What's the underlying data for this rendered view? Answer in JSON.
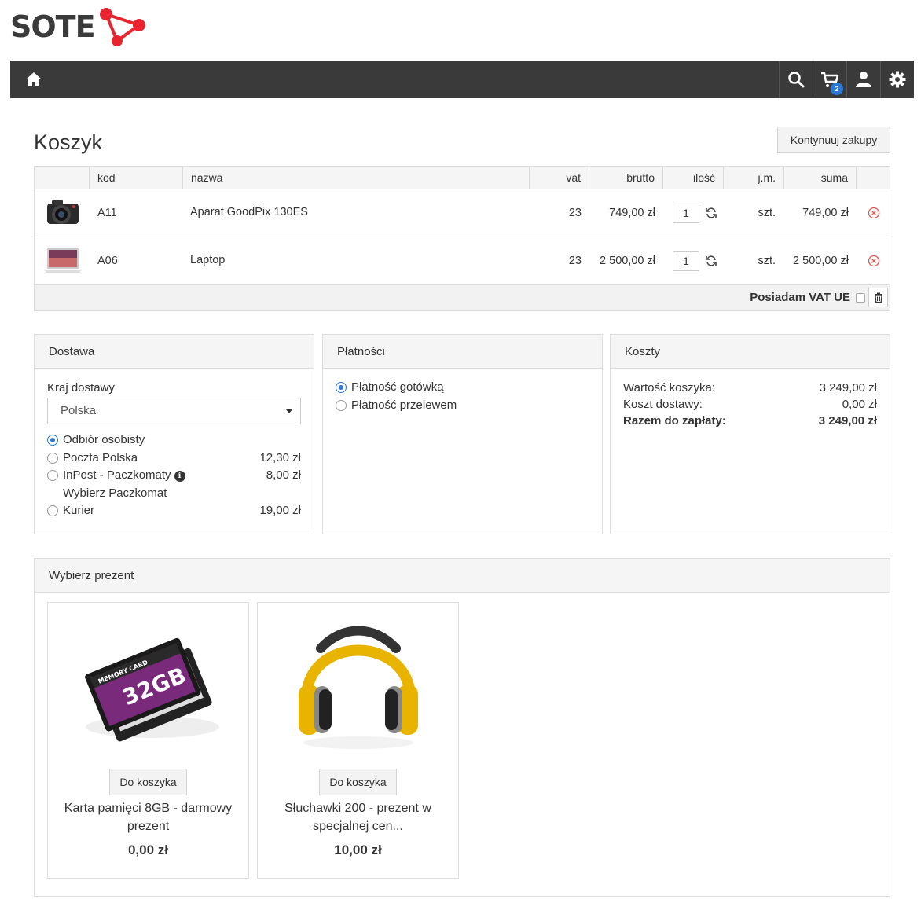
{
  "brand": {
    "name": "SOTE",
    "accent": "#e8242f"
  },
  "nav": {
    "cart_count": "2",
    "icons": [
      "home-icon",
      "search-icon",
      "cart-icon",
      "user-icon",
      "gear-icon"
    ]
  },
  "page": {
    "title": "Koszyk",
    "continue_label": "Kontynuuj zakupy"
  },
  "cart": {
    "columns": {
      "kod": "kod",
      "nazwa": "nazwa",
      "vat": "vat",
      "brutto": "brutto",
      "ilosc": "ilość",
      "jm": "j.m.",
      "suma": "suma"
    },
    "items": [
      {
        "kod": "A11",
        "nazwa": "Aparat GoodPix 130ES",
        "vat": "23",
        "brutto": "749,00 zł",
        "qty": "1",
        "jm": "szt.",
        "suma": "749,00 zł"
      },
      {
        "kod": "A06",
        "nazwa": "Laptop",
        "vat": "23",
        "brutto": "2 500,00 zł",
        "qty": "1",
        "jm": "szt.",
        "suma": "2 500,00 zł"
      }
    ],
    "vat_ue_label": "Posiadam VAT UE"
  },
  "delivery": {
    "title": "Dostawa",
    "country_label": "Kraj dostawy",
    "country_value": "Polska",
    "options": [
      {
        "label": "Odbiór osobisty",
        "price": "",
        "selected": true
      },
      {
        "label": "Poczta Polska",
        "price": "12,30 zł",
        "selected": false
      },
      {
        "label": "InPost - Paczkomaty",
        "price": "8,00 zł",
        "selected": false,
        "sub": "Wybierz Paczkomat"
      },
      {
        "label": "Kurier",
        "price": "19,00 zł",
        "selected": false
      }
    ]
  },
  "payment": {
    "title": "Płatności",
    "options": [
      {
        "label": "Płatność gotówką",
        "selected": true
      },
      {
        "label": "Płatność przelewem",
        "selected": false
      }
    ]
  },
  "costs": {
    "title": "Koszty",
    "cart_value_label": "Wartość koszyka:",
    "cart_value": "3 249,00 zł",
    "shipping_label": "Koszt dostawy:",
    "shipping": "0,00 zł",
    "total_label": "Razem do zapłaty:",
    "total": "3 249,00 zł"
  },
  "gifts": {
    "title": "Wybierz prezent",
    "items": [
      {
        "button": "Do koszyka",
        "name": "Karta pamięci 8GB - darmowy prezent",
        "price": "0,00 zł",
        "image_text_top": "MEMORY CARD",
        "image_text_main": "32GB"
      },
      {
        "button": "Do koszyka",
        "name": "Słuchawki 200 - prezent w specjalnej cen...",
        "price": "10,00 zł"
      }
    ]
  }
}
